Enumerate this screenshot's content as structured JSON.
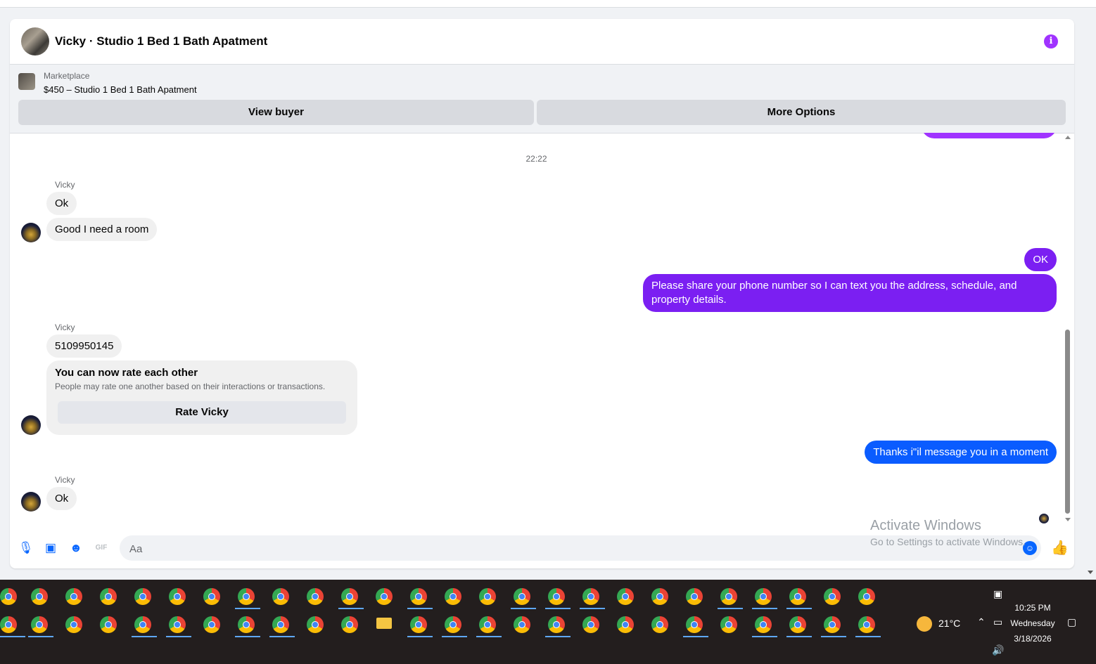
{
  "header": {
    "title": "Vicky · Studio 1 Bed 1 Bath Apatment"
  },
  "marketplace": {
    "label": "Marketplace",
    "item": "$450 – Studio 1 Bed 1 Bath Apatment",
    "view_buyer": "View buyer",
    "more_options": "More Options"
  },
  "conversation": {
    "timestamp": "22:22",
    "sender_name": "Vicky",
    "msg_ok_1": "Ok",
    "msg_room": "Good I need a room",
    "out_ok": "OK",
    "out_phone": "Please share your phone number so I can text you the address, schedule, and property details.",
    "msg_phone_number": "5109950145",
    "rate_title": "You can now rate each other",
    "rate_desc": "People may rate one another based on their interactions or transactions.",
    "rate_button": "Rate Vicky",
    "out_thanks": "Thanks i\"il message you in a moment",
    "msg_ok_2": "Ok"
  },
  "composer": {
    "placeholder": "Aa",
    "gif_label": "GIF"
  },
  "watermark": {
    "line1": "Activate Windows",
    "line2": "Go to Settings to activate Windows."
  },
  "taskbar": {
    "temperature": "21°C",
    "time": "10:25 PM",
    "day": "Wednesday",
    "date": "3/18/2026"
  },
  "colors": {
    "purple_bubble": "#7b1ff2",
    "blue_bubble": "#0a5cff",
    "accent": "#0866ff",
    "info": "#a033ff"
  }
}
